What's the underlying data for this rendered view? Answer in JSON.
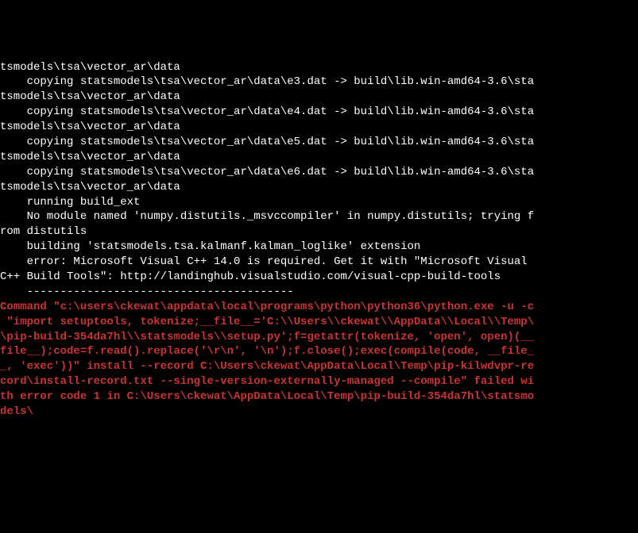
{
  "terminal": {
    "lines": [
      {
        "type": "normal",
        "text": "tsmodels\\tsa\\vector_ar\\data"
      },
      {
        "type": "normal",
        "text": "    copying statsmodels\\tsa\\vector_ar\\data\\e3.dat -> build\\lib.win-amd64-3.6\\sta"
      },
      {
        "type": "normal",
        "text": "tsmodels\\tsa\\vector_ar\\data"
      },
      {
        "type": "normal",
        "text": "    copying statsmodels\\tsa\\vector_ar\\data\\e4.dat -> build\\lib.win-amd64-3.6\\sta"
      },
      {
        "type": "normal",
        "text": "tsmodels\\tsa\\vector_ar\\data"
      },
      {
        "type": "normal",
        "text": "    copying statsmodels\\tsa\\vector_ar\\data\\e5.dat -> build\\lib.win-amd64-3.6\\sta"
      },
      {
        "type": "normal",
        "text": "tsmodels\\tsa\\vector_ar\\data"
      },
      {
        "type": "normal",
        "text": "    copying statsmodels\\tsa\\vector_ar\\data\\e6.dat -> build\\lib.win-amd64-3.6\\sta"
      },
      {
        "type": "normal",
        "text": "tsmodels\\tsa\\vector_ar\\data"
      },
      {
        "type": "normal",
        "text": "    running build_ext"
      },
      {
        "type": "normal",
        "text": "    No module named 'numpy.distutils._msvccompiler' in numpy.distutils; trying f"
      },
      {
        "type": "normal",
        "text": "rom distutils"
      },
      {
        "type": "normal",
        "text": "    building 'statsmodels.tsa.kalmanf.kalman_loglike' extension"
      },
      {
        "type": "normal",
        "text": "    error: Microsoft Visual C++ 14.0 is required. Get it with \"Microsoft Visual "
      },
      {
        "type": "normal",
        "text": "C++ Build Tools\": http://landinghub.visualstudio.com/visual-cpp-build-tools"
      },
      {
        "type": "normal",
        "text": ""
      },
      {
        "type": "normal",
        "text": "    ----------------------------------------"
      },
      {
        "type": "error",
        "text": "Command \"c:\\users\\ckewat\\appdata\\local\\programs\\python\\python36\\python.exe -u -c"
      },
      {
        "type": "error",
        "text": " \"import setuptools, tokenize;__file__='C:\\\\Users\\\\ckewat\\\\AppData\\\\Local\\\\Temp\\"
      },
      {
        "type": "error",
        "text": "\\pip-build-354da7hl\\\\statsmodels\\\\setup.py';f=getattr(tokenize, 'open', open)(__"
      },
      {
        "type": "error",
        "text": "file__);code=f.read().replace('\\r\\n', '\\n');f.close();exec(compile(code, __file_"
      },
      {
        "type": "error",
        "text": "_, 'exec'))\" install --record C:\\Users\\ckewat\\AppData\\Local\\Temp\\pip-kilwdvpr-re"
      },
      {
        "type": "error",
        "text": "cord\\install-record.txt --single-version-externally-managed --compile\" failed wi"
      },
      {
        "type": "error",
        "text": "th error code 1 in C:\\Users\\ckewat\\AppData\\Local\\Temp\\pip-build-354da7hl\\statsmo"
      },
      {
        "type": "error",
        "text": "dels\\"
      }
    ]
  }
}
